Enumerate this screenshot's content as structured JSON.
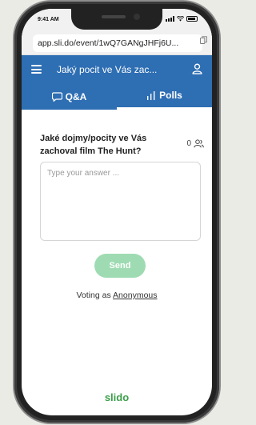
{
  "status": {
    "time": "9:41 AM"
  },
  "browser": {
    "url": "app.sli.do/event/1wQ7GANgJHFj6U..."
  },
  "header": {
    "title": "Jaký pocit ve Vás zac..."
  },
  "tabs": [
    {
      "label": "Q&A"
    },
    {
      "label": "Polls"
    }
  ],
  "poll": {
    "question": "Jaké dojmy/pocity ve Vás zachoval film The Hunt?",
    "voter_count": "0",
    "answer_placeholder": "Type your answer ...",
    "send_label": "Send",
    "voting_prefix": "Voting as",
    "voting_identity": "Anonymous"
  },
  "brand": {
    "name": "slido"
  },
  "colors": {
    "primary": "#2e6eb3",
    "send": "#9edbb2",
    "brand": "#3c9e49"
  },
  "icons": [
    "menu-icon",
    "user-icon",
    "chat-icon",
    "bar-chart-icon",
    "people-icon",
    "copy-icon"
  ]
}
